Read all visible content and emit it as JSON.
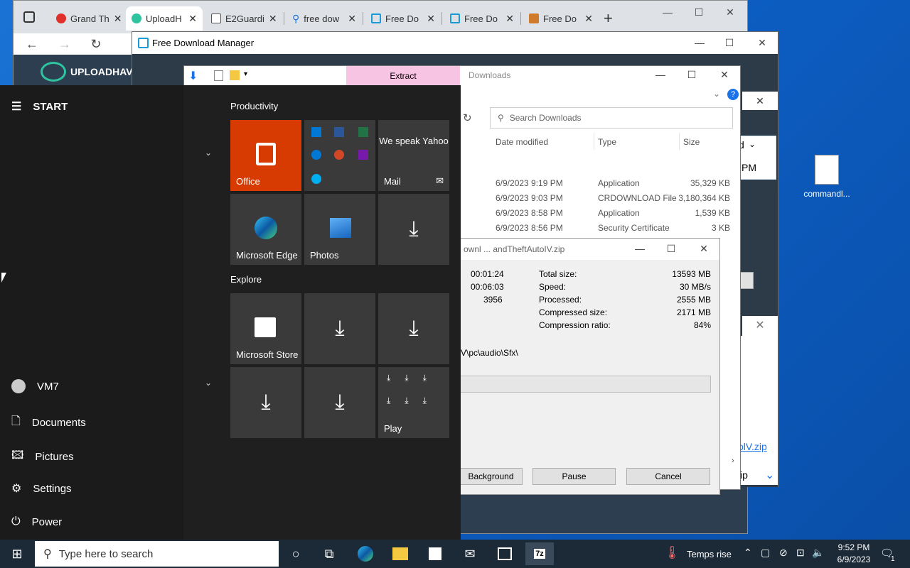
{
  "browser": {
    "tabs": [
      {
        "label": "Grand Th",
        "color": "#e0302c"
      },
      {
        "label": "UploadH",
        "color": "#2ec4a0"
      },
      {
        "label": "E2Guardi",
        "color": "#ffffff"
      },
      {
        "label": "free dow",
        "color": "#1a73e8"
      },
      {
        "label": "Free Do",
        "color": "#1a9ad6"
      },
      {
        "label": "Free Do",
        "color": "#1a9ad6"
      },
      {
        "label": "Free Do",
        "color": "#d07a2c"
      }
    ],
    "new_tab": "+",
    "site_logo": "UPLOADHAV",
    "plus_label": "+"
  },
  "fdm": {
    "title": "Free Download Manager",
    "panel_text": "d",
    "panel_time": "PM",
    "panel_zip": "zip",
    "panel_link": "olV.zip",
    "panel_dots": "..."
  },
  "explorer": {
    "extract_tab": "Extract",
    "title": "Downloads",
    "search_placeholder": "Search Downloads",
    "columns": [
      "Date modified",
      "Type",
      "Size"
    ],
    "rows": [
      {
        "date": "6/9/2023 9:19 PM",
        "type": "Application",
        "size": "35,329 KB"
      },
      {
        "date": "6/9/2023 9:03 PM",
        "type": "CRDOWNLOAD File",
        "size": "3,180,364 KB"
      },
      {
        "date": "6/9/2023 8:58 PM",
        "type": "Application",
        "size": "1,539 KB"
      },
      {
        "date": "6/9/2023 8:56 PM",
        "type": "Security Certificate",
        "size": "3 KB"
      }
    ]
  },
  "sevenzip": {
    "title": "ownl ... andTheftAutoIV.zip",
    "left_values": [
      "00:01:24",
      "00:06:03",
      "3956"
    ],
    "stats": [
      {
        "label": "Total size:",
        "value": "13593 MB"
      },
      {
        "label": "Speed:",
        "value": "30 MB/s"
      },
      {
        "label": "Processed:",
        "value": "2555 MB"
      },
      {
        "label": "Compressed size:",
        "value": "2171 MB"
      },
      {
        "label": "Compression ratio:",
        "value": "84%"
      }
    ],
    "path": "V\\pc\\audio\\Sfx\\",
    "buttons": {
      "background": "Background",
      "pause": "Pause",
      "cancel": "Cancel"
    }
  },
  "startmenu": {
    "header": "START",
    "user": "VM7",
    "items": [
      "Documents",
      "Pictures",
      "Settings",
      "Power"
    ],
    "group1": "Productivity",
    "group2": "Explore",
    "tiles": {
      "office": "Office",
      "mail_text": "We speak Yahoo",
      "mail": "Mail",
      "edge": "Microsoft Edge",
      "photos": "Photos",
      "store": "Microsoft Store",
      "play": "Play"
    }
  },
  "desktop": {
    "icon_label": "commandl..."
  },
  "taskbar": {
    "search_placeholder": "Type here to search",
    "weather": "Temps rise",
    "time": "9:52 PM",
    "date": "6/9/2023",
    "notification_count": "1"
  }
}
